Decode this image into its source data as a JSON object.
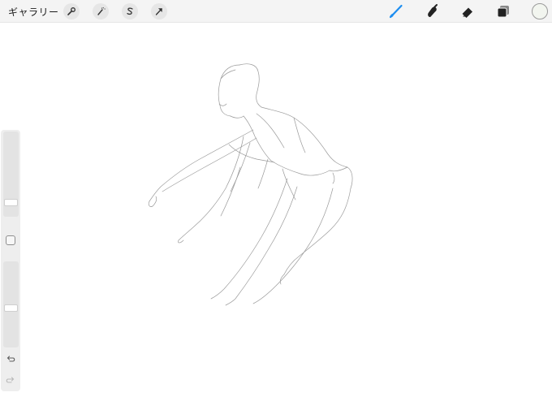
{
  "topbar": {
    "gallery_label": "ギャラリー",
    "left_tools": [
      "wrench-icon",
      "magic-wand-icon",
      "selection-s-icon",
      "transform-arrow-icon"
    ],
    "right_tools": [
      "brush-icon",
      "smudge-icon",
      "eraser-icon",
      "layers-icon"
    ],
    "active_tool": "brush-icon",
    "active_color": "#1e8ef0",
    "current_color": "#f2f5ef"
  },
  "sidebar": {
    "brush_size_level": 0.14,
    "opacity_level": 0.45,
    "controls": [
      "brush-size-slider",
      "modify-button",
      "opacity-slider",
      "undo-icon",
      "redo-icon"
    ]
  }
}
